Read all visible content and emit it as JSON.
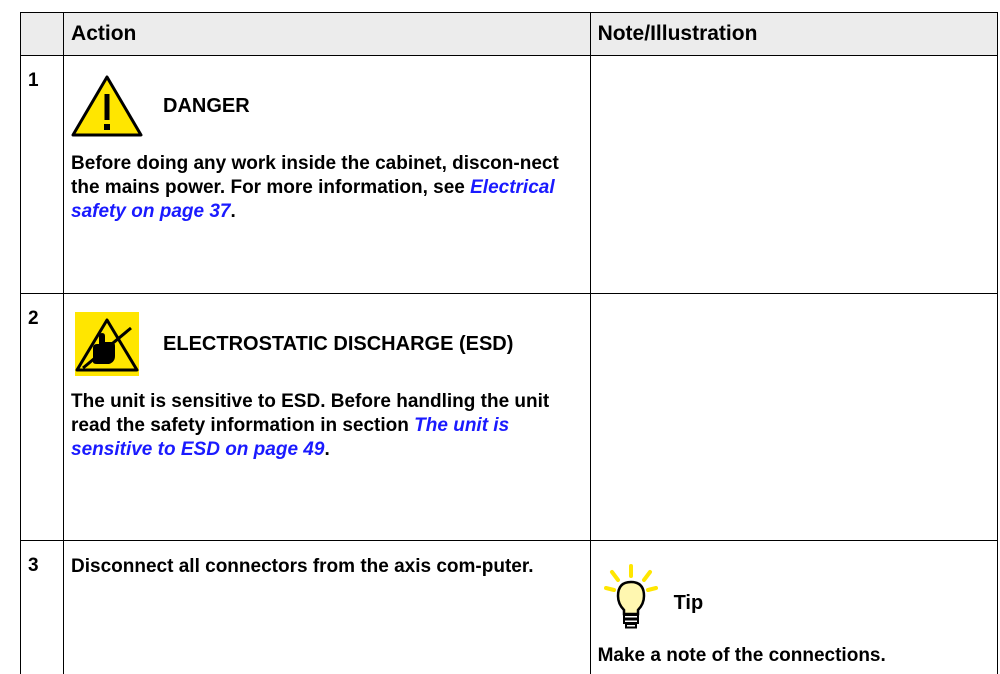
{
  "table": {
    "headers": {
      "number": "",
      "action": "Action",
      "note": "Note/Illustration"
    },
    "rows": [
      {
        "number": "1",
        "admonition": {
          "type": "danger",
          "icon": "warning-triangle-icon",
          "title": "DANGER"
        },
        "text_before": "Before doing any work inside the cabinet, discon-nect the mains power. For more information, see ",
        "link": "Electrical safety on page 37",
        "text_after": ".",
        "note": ""
      },
      {
        "number": "2",
        "admonition": {
          "type": "esd",
          "icon": "esd-hand-icon",
          "title": "ELECTROSTATIC DISCHARGE (ESD)"
        },
        "text_before": "The unit is sensitive to ESD. Before handling the unit read the safety information in section ",
        "link": "The unit is sensitive to ESD on page 49",
        "text_after": ".",
        "note": ""
      },
      {
        "number": "3",
        "text": "Disconnect all connectors from the axis com-puter.",
        "tip": {
          "icon": "lightbulb-icon",
          "title": "Tip",
          "text": "Make a note of the connections."
        }
      }
    ]
  },
  "colors": {
    "link": "#1a1aff",
    "warning_yellow": "#ffe600",
    "header_bg": "#ececec"
  }
}
